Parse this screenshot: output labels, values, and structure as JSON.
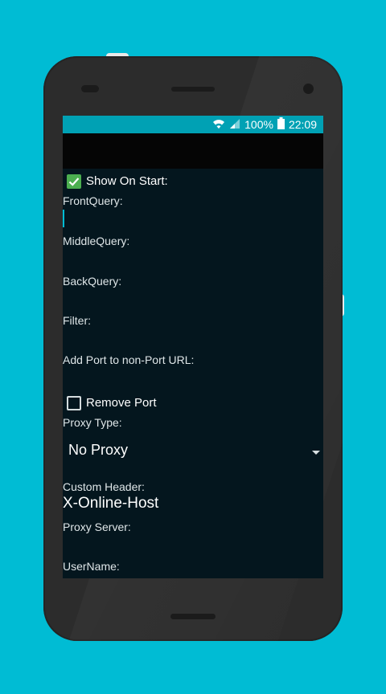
{
  "colors": {
    "background": "#00bcd4",
    "status_bar": "#00a1b4",
    "app_bar": "#050505",
    "screen": "#04161e",
    "checkbox_on": "#4caf50",
    "accent": "#00bcd4"
  },
  "status_bar": {
    "battery": "100%",
    "time": "22:09",
    "icons": [
      "wifi-icon",
      "signal-icon",
      "battery-icon"
    ]
  },
  "form": {
    "show_on_start": {
      "label": "Show On Start:",
      "checked": true
    },
    "front_query": {
      "label": "FrontQuery:",
      "value": ""
    },
    "middle_query": {
      "label": "MiddleQuery:",
      "value": ""
    },
    "back_query": {
      "label": "BackQuery:",
      "value": ""
    },
    "filter": {
      "label": "Filter:",
      "value": ""
    },
    "add_port": {
      "label": "Add Port to non-Port URL:",
      "value": ""
    },
    "remove_port": {
      "label": "Remove Port",
      "checked": false
    },
    "proxy_type": {
      "label": "Proxy Type:",
      "selected": "No Proxy"
    },
    "custom_header": {
      "label": "Custom Header:",
      "value": "X-Online-Host"
    },
    "proxy_server": {
      "label": "Proxy Server:",
      "value": ""
    },
    "username": {
      "label": "UserName:",
      "value": ""
    }
  }
}
